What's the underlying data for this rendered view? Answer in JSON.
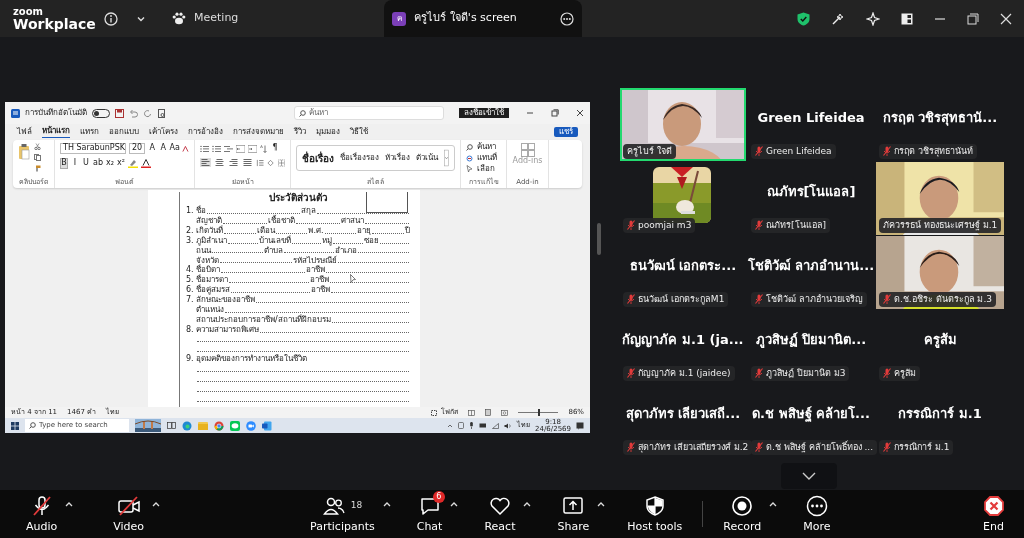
{
  "top_bar": {
    "logo_small": "zoom",
    "logo_large": "Workplace",
    "meeting_label": "Meeting",
    "share_tab": {
      "initial": "ค",
      "title": "ครูไบร์ ใจดี's screen"
    }
  },
  "shared_screen": {
    "word": {
      "autosave_label": "การบันทึกอัตโนมัติ",
      "autosave_on": false,
      "search_placeholder": "ค้นหา",
      "sign_in": "ลงชื่อเข้าใช้",
      "share_button": "แชร์",
      "ribbon_tabs": [
        {
          "label": "ไฟล์",
          "selected": false
        },
        {
          "label": "หน้าแรก",
          "selected": true
        },
        {
          "label": "แทรก",
          "selected": false
        },
        {
          "label": "ออกแบบ",
          "selected": false
        },
        {
          "label": "เค้าโครง",
          "selected": false
        },
        {
          "label": "การอ้างอิง",
          "selected": false
        },
        {
          "label": "การส่งจดหมาย",
          "selected": false
        },
        {
          "label": "รีวิว",
          "selected": false
        },
        {
          "label": "มุมมอง",
          "selected": false
        },
        {
          "label": "วิธีใช้",
          "selected": false
        }
      ],
      "font_name": "TH SarabunPSK",
      "font_size": "20",
      "font_tools": [
        "A",
        "A",
        "Aa"
      ],
      "format_buttons": [
        {
          "label": "B",
          "selected": true
        },
        {
          "label": "I",
          "selected": false
        },
        {
          "label": "U",
          "selected": false
        },
        {
          "label": "ab",
          "selected": false
        },
        {
          "label": "x₂",
          "selected": false
        },
        {
          "label": "x²",
          "selected": false
        }
      ],
      "alignments": [
        {
          "kind": "left",
          "selected": true
        },
        {
          "kind": "center",
          "selected": false
        },
        {
          "kind": "right",
          "selected": false
        },
        {
          "kind": "justify",
          "selected": false
        }
      ],
      "pilcrow": "¶",
      "styles": [
        "ชื่อเรื่อง",
        "ชื่อเรื่องรอง",
        "หัวเรื่อง",
        "ตัวเน้น"
      ],
      "editing": [
        "ค้นหา",
        "แทนที่",
        "เลือก"
      ],
      "addin": "Add-ins",
      "group_labels": [
        "คลิปบอร์ด",
        "ฟอนต์",
        "ย่อหน้า",
        "สไตล์",
        "การแก้ไข",
        "Add-in"
      ],
      "doc_title": "ประวัติส่วนตัว",
      "form_lines": [
        {
          "kind": "field",
          "number": "1.",
          "fields": [
            "ชื่อ",
            "สกุล"
          ]
        },
        {
          "kind": "field",
          "fields": [
            "สัญชาติ",
            "เชื้อชาติ",
            "ศาสนา"
          ]
        },
        {
          "kind": "field",
          "number": "2.",
          "fields": [
            "เกิดวันที่",
            "เดือน",
            "พ.ศ.",
            "อายุ"
          ],
          "end": "ปี"
        },
        {
          "kind": "field",
          "number": "3.",
          "fields": [
            "ภูมิลำเนา",
            "บ้านเลขที่",
            "หมู่",
            "ซอย"
          ]
        },
        {
          "kind": "field",
          "fields": [
            "ถนน",
            "ตำบล",
            "อำเภอ"
          ]
        },
        {
          "kind": "field",
          "fields": [
            "จังหวัด",
            "รหัสไปรษณีย์"
          ]
        },
        {
          "kind": "field",
          "number": "4.",
          "fields": [
            "ชื่อบิดา",
            "อาชีพ"
          ]
        },
        {
          "kind": "field",
          "number": "5.",
          "fields": [
            "ชื่อมารดา",
            "อาชีพ"
          ]
        },
        {
          "kind": "field",
          "number": "6.",
          "fields": [
            "ชื่อคู่สมรส",
            "อาชีพ"
          ]
        },
        {
          "kind": "field",
          "number": "7.",
          "fields": [
            "ลักษณะของอาชีพ"
          ]
        },
        {
          "kind": "field",
          "fields": [
            "ตำแหน่ง"
          ]
        },
        {
          "kind": "field",
          "fields": [
            "สถานประกอบการอาชีพ/สถานที่ฝึกอบรม"
          ]
        },
        {
          "kind": "field",
          "number": "8.",
          "fields": [
            "ความสามารถพิเศษ"
          ]
        },
        {
          "kind": "blank"
        },
        {
          "kind": "blank"
        },
        {
          "kind": "label",
          "number": "9.",
          "fields": [
            "อุดมคติของการทำงานหรือในชีวิต"
          ]
        },
        {
          "kind": "blank"
        },
        {
          "kind": "blank"
        },
        {
          "kind": "blank"
        },
        {
          "kind": "blank"
        }
      ],
      "status": {
        "page": "หน้า 4 จาก 11",
        "words": "1467 คำ",
        "language": "ไทย",
        "focus": "โฟกัส",
        "zoom": "86%",
        "level": 0.5
      }
    },
    "taskbar": {
      "search_placeholder": "Type here to search",
      "language": "ไทย",
      "time": "9:18",
      "date": "24/6/2569"
    }
  },
  "participants": [
    {
      "kind": "video",
      "label": "ครูไบร์ ใจดี",
      "muted": false,
      "speaking": true
    },
    {
      "kind": "name",
      "display_name": "Green Lifeidea",
      "label": "Green Lifeidea",
      "muted": true,
      "speaking": false
    },
    {
      "kind": "name",
      "display_name": "กรฤต วชิรสุทธานั...",
      "label": "กรฤต วชิรสุทธานันท์",
      "muted": true,
      "speaking": false
    },
    {
      "kind": "avatar",
      "label": "poomjai m3",
      "muted": true,
      "speaking": false
    },
    {
      "kind": "name",
      "display_name": "ณภัทร[โนแอล]",
      "label": "ณภัทร[โนแอล]",
      "muted": true,
      "speaking": false
    },
    {
      "kind": "video",
      "label": "ภัควรรธน์ ทองธนะเศรษฐ์ ม.1",
      "muted": false,
      "speaking": false
    },
    {
      "kind": "name",
      "display_name": "ธนวัฒน์ เอกตระ...",
      "label": "ธนวัฒน์ เอกตระกูลM1",
      "muted": true,
      "speaking": false
    },
    {
      "kind": "name",
      "display_name": "โชติวัฒ์ ลาภอำนาน...",
      "label": "โชติวัฒ์ ลาภอำนวยเจริญ",
      "muted": true,
      "speaking": false
    },
    {
      "kind": "video",
      "label": "ด.ช.อชิระ ตันตระกูล ม.3",
      "muted": true,
      "speaking": false
    },
    {
      "kind": "name",
      "display_name": "กัญญาภัค ม.1 (ja...",
      "label": "กัญญาภัค ม.1 (jaidee)",
      "muted": true,
      "speaking": false
    },
    {
      "kind": "name",
      "display_name": "ภูวสิษฏ์ ปิยมานิต...",
      "label": "ภูวสิษฏ์ ปิยมานิต ม3",
      "muted": true,
      "speaking": false
    },
    {
      "kind": "name",
      "display_name": "ครูส้ม",
      "label": "ครูส้ม",
      "muted": true,
      "speaking": false
    },
    {
      "kind": "name",
      "display_name": "สุดาภัทร เลียวเสถี...",
      "label": "สุดาภัทร เลียวเสถียรวงศ์ ม.2",
      "muted": true,
      "speaking": false
    },
    {
      "kind": "name",
      "display_name": "ด.ช พสิษฐ์ คล้ายโ...",
      "label": "ด.ช พสิษฐ์ คล้ายโพธิ์ทอง ...",
      "muted": true,
      "speaking": false
    },
    {
      "kind": "name",
      "display_name": "กรรณิการ์ ม.1",
      "label": "กรรณิการ์ ม.1",
      "muted": true,
      "speaking": false
    }
  ],
  "toolbar": [
    {
      "kind": "audio",
      "label": "Audio",
      "off": true,
      "caret": true
    },
    {
      "kind": "video",
      "label": "Video",
      "off": true,
      "caret": true
    },
    {
      "kind": "participants",
      "label": "Participants",
      "count": "18",
      "caret": true
    },
    {
      "kind": "chat",
      "label": "Chat",
      "badge": "6",
      "caret": true
    },
    {
      "kind": "react",
      "label": "React",
      "caret": true
    },
    {
      "kind": "share",
      "label": "Share",
      "caret": true
    },
    {
      "kind": "host",
      "label": "Host tools",
      "caret": false
    },
    {
      "kind": "record",
      "label": "Record",
      "caret": true
    },
    {
      "kind": "more",
      "label": "More",
      "caret": false
    },
    {
      "kind": "end",
      "label": "End",
      "caret": false
    }
  ]
}
